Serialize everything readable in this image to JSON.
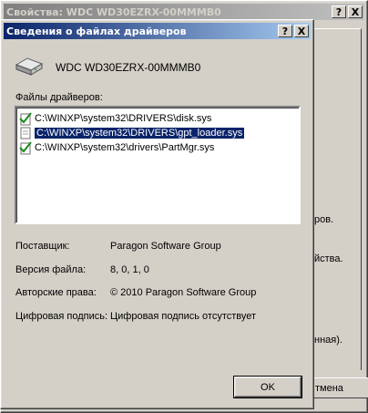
{
  "background_window": {
    "title": "Свойства: WDC WD30EZRX-00MMMB0",
    "help_btn": "?",
    "close_btn": "X",
    "clipped_text_1": "ров.",
    "clipped_text_2": "йства.",
    "clipped_text_3": "нная).",
    "cancel_label": "тмена"
  },
  "dialog": {
    "title": "Сведения о файлах драйверов",
    "help_btn": "?",
    "close_btn": "X",
    "device_name": "WDC WD30EZRX-00MMMB0",
    "files_label": "Файлы драйверов:",
    "files": [
      {
        "path": "C:\\WINXP\\system32\\DRIVERS\\disk.sys",
        "selected": false,
        "signed": true
      },
      {
        "path": "C:\\WINXP\\system32\\DRIVERS\\gpt_loader.sys",
        "selected": true,
        "signed": false
      },
      {
        "path": "C:\\WINXP\\system32\\drivers\\PartMgr.sys",
        "selected": false,
        "signed": true
      }
    ],
    "details": {
      "provider_label": "Поставщик:",
      "provider_value": "Paragon Software Group",
      "version_label": "Версия файла:",
      "version_value": "8, 0, 1, 0",
      "copyright_label": "Авторские права:",
      "copyright_value": "© 2010 Paragon Software Group",
      "signature_label": "Цифровая подпись:",
      "signature_value": "Цифровая подпись отсутствует"
    },
    "ok_label": "OK"
  },
  "colors": {
    "face": "#d4d0c8",
    "active_title": "#0a246a",
    "selection": "#0a246a",
    "inactive_title": "#808080"
  }
}
